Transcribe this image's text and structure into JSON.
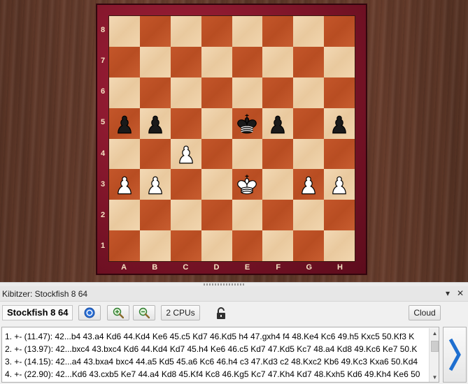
{
  "board": {
    "ranks": [
      "8",
      "7",
      "6",
      "5",
      "4",
      "3",
      "2",
      "1"
    ],
    "files": [
      "A",
      "B",
      "C",
      "D",
      "E",
      "F",
      "G",
      "H"
    ],
    "pieces": [
      {
        "square": "a5",
        "type": "pawn",
        "color": "black"
      },
      {
        "square": "b5",
        "type": "pawn",
        "color": "black"
      },
      {
        "square": "e5",
        "type": "king",
        "color": "black"
      },
      {
        "square": "f5",
        "type": "pawn",
        "color": "black"
      },
      {
        "square": "h5",
        "type": "pawn",
        "color": "black"
      },
      {
        "square": "c4",
        "type": "pawn",
        "color": "white"
      },
      {
        "square": "a3",
        "type": "pawn",
        "color": "white"
      },
      {
        "square": "b3",
        "type": "pawn",
        "color": "white"
      },
      {
        "square": "e3",
        "type": "king",
        "color": "white"
      },
      {
        "square": "g3",
        "type": "pawn",
        "color": "white"
      },
      {
        "square": "h3",
        "type": "pawn",
        "color": "white"
      }
    ]
  },
  "kibitzer": {
    "title": "Kibitzer: Stockfish 8 64",
    "engine_name": "Stockfish 8 64",
    "cpus_label": "2 CPUs",
    "cloud_label": "Cloud",
    "lines": [
      "1. +- (11.47): 42...b4 43.a4 Kd6 44.Kd4 Ke6 45.c5 Kd7 46.Kd5 h4 47.gxh4 f4 48.Ke4 Kc6 49.h5 Kxc5 50.Kf3 K",
      "2. +- (13.97): 42...bxc4 43.bxc4 Kd6 44.Kd4 Kd7 45.h4 Ke6 46.c5 Kd7 47.Kd5 Kc7 48.a4 Kd8 49.Kc6 Ke7 50.K",
      "3. +- (14.15): 42...a4 43.bxa4 bxc4 44.a5 Kd5 45.a6 Kc6 46.h4 c3 47.Kd3 c2 48.Kxc2 Kb6 49.Kc3 Kxa6 50.Kd4",
      "4. +- (22.90): 42...Kd6 43.cxb5 Ke7 44.a4 Kd8 45.Kf4 Kc8 46.Kg5 Kc7 47.Kh4 Kd7 48.Kxh5 Kd6 49.Kh4 Ke6 50"
    ]
  },
  "colors": {
    "light_square": "#f0d4ab",
    "dark_square": "#c0532a",
    "frame": "#8a1a2e",
    "accent_arrow": "#1e6fd0"
  }
}
